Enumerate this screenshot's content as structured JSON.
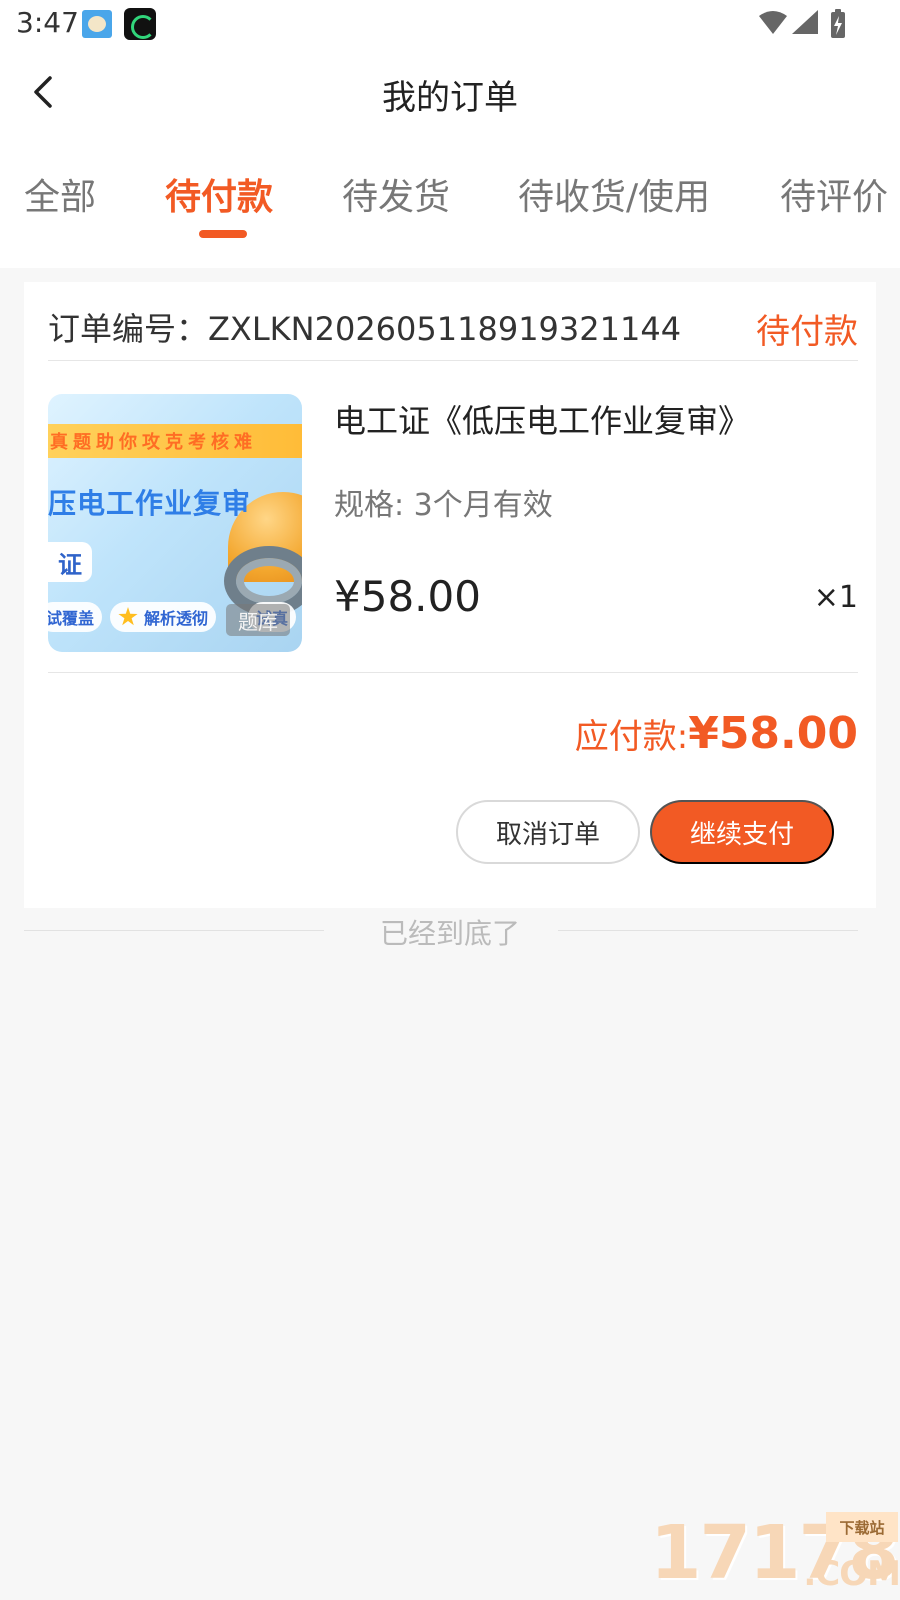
{
  "statusBar": {
    "time": "3:47",
    "icons": [
      "app-avatar-icon",
      "app-moon-icon",
      "wifi-icon",
      "signal-icon",
      "battery-icon"
    ]
  },
  "header": {
    "title": "我的订单",
    "backIcon": "back-arrow-icon"
  },
  "tabs": [
    {
      "label": "全部"
    },
    {
      "label": "待付款",
      "active": true
    },
    {
      "label": "待发货"
    },
    {
      "label": "待收货/使用"
    },
    {
      "label": "待评价"
    }
  ],
  "order": {
    "numberLabel": "订单编号：ZXLKN202605118919321144",
    "status": "待付款",
    "product": {
      "title": "电工证《低压电工作业复审》",
      "spec": "规格: 3个月有效",
      "price": "¥58.00",
      "quantity": "×1",
      "thumbnail": {
        "banner": "真题助你攻克考核难",
        "headline": "压电工作业复审",
        "badge": "证",
        "feature1": "试覆盖",
        "feature2": "解析透彻",
        "feature3": "试真",
        "tag": "题库"
      }
    },
    "payable": {
      "label": "应付款:",
      "amount": "¥58.00"
    },
    "buttons": {
      "cancel": "取消订单",
      "pay": "继续支付"
    }
  },
  "footer": {
    "endText": "已经到底了"
  },
  "watermark": {
    "number": "17178",
    "sub": "下载站",
    "domain": ".COM"
  },
  "colors": {
    "accent": "#f25a24",
    "background": "#f7f7f7"
  }
}
